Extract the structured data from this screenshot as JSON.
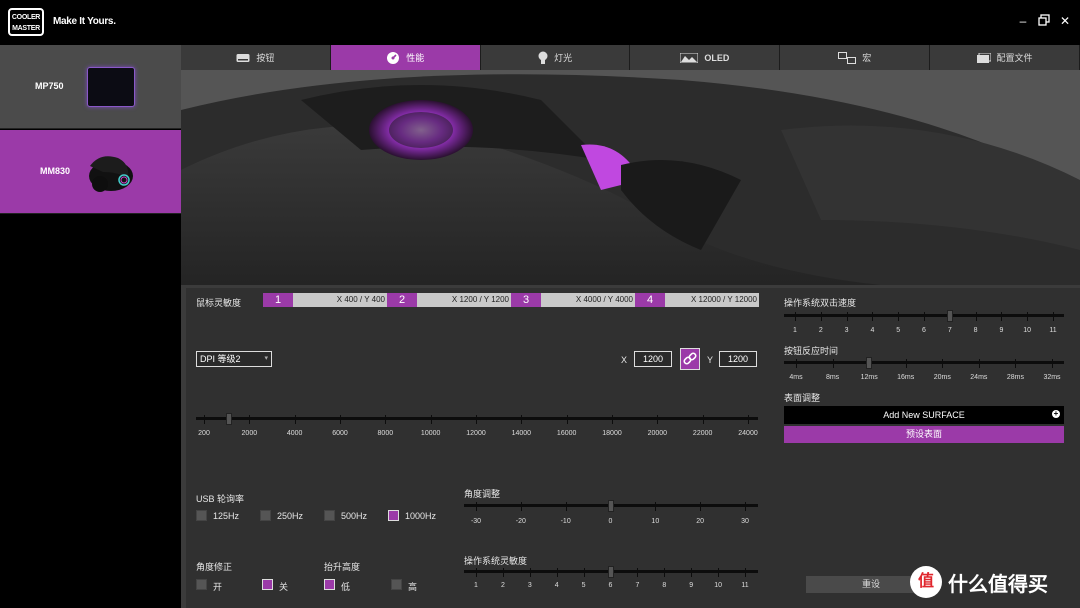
{
  "app": {
    "logo_text": "COOLER MASTER",
    "slogan": "Make It Yours.",
    "window_controls": [
      "minimize",
      "maximize",
      "close"
    ]
  },
  "devices": [
    {
      "name": "MP750",
      "selected": false
    },
    {
      "name": "MM830",
      "selected": true
    }
  ],
  "tabs": [
    {
      "label": "按钮",
      "icon": "keyboard-icon",
      "active": false
    },
    {
      "label": "性能",
      "icon": "speedometer-icon",
      "active": true
    },
    {
      "label": "灯光",
      "icon": "bulb-icon",
      "active": false
    },
    {
      "label": "OLED",
      "icon": "display-icon",
      "active": false
    },
    {
      "label": "宏",
      "icon": "macro-icon",
      "active": false
    },
    {
      "label": "配置文件",
      "icon": "folder-icon",
      "active": false
    }
  ],
  "dpi": {
    "title": "鼠标灵敏度",
    "stages": [
      {
        "num": "1",
        "value": "X 400 / Y 400"
      },
      {
        "num": "2",
        "value": "X 1200 / Y 1200"
      },
      {
        "num": "3",
        "value": "X 4000 / Y 4000"
      },
      {
        "num": "4",
        "value": "X 12000 / Y 12000"
      }
    ],
    "level_select": "DPI 等级2",
    "x_label": "X",
    "x_value": "1200",
    "y_label": "Y",
    "y_value": "1200",
    "slider_ticks": [
      "200",
      "2000",
      "4000",
      "6000",
      "8000",
      "10000",
      "12000",
      "14000",
      "16000",
      "18000",
      "20000",
      "22000",
      "24000"
    ],
    "slider_value": 1200
  },
  "usb_polling": {
    "title": "USB 轮询率",
    "options": [
      {
        "label": "125Hz",
        "checked": false
      },
      {
        "label": "250Hz",
        "checked": false
      },
      {
        "label": "500Hz",
        "checked": false
      },
      {
        "label": "1000Hz",
        "checked": true
      }
    ]
  },
  "angle_adjust": {
    "title": "角度调整",
    "ticks": [
      "-30",
      "-20",
      "-10",
      "0",
      "10",
      "20",
      "30"
    ],
    "value": 0
  },
  "angle_snap": {
    "title": "角度修正",
    "options": [
      {
        "label": "开",
        "checked": false
      },
      {
        "label": "关",
        "checked": true
      }
    ]
  },
  "lift_off": {
    "title": "抬升高度",
    "options": [
      {
        "label": "低",
        "checked": true
      },
      {
        "label": "高",
        "checked": false
      }
    ]
  },
  "os_sensitivity": {
    "title": "操作系统灵敏度",
    "ticks": [
      "1",
      "2",
      "3",
      "4",
      "5",
      "6",
      "7",
      "8",
      "9",
      "10",
      "11"
    ],
    "value": 6
  },
  "double_click": {
    "title": "操作系统双击速度",
    "ticks": [
      "1",
      "2",
      "3",
      "4",
      "5",
      "6",
      "7",
      "8",
      "9",
      "10",
      "11"
    ],
    "value": 7
  },
  "response_time": {
    "title": "按钮反应时间",
    "ticks": [
      "4ms",
      "8ms",
      "12ms",
      "16ms",
      "20ms",
      "24ms",
      "28ms",
      "32ms"
    ],
    "value": "12ms"
  },
  "surface": {
    "title": "表面调整",
    "add_label": "Add New SURFACE",
    "preset_label": "预设表面"
  },
  "reset_label": "重设",
  "watermark": {
    "symbol": "值",
    "text": "什么值得买"
  },
  "colors": {
    "accent": "#9b3aa8",
    "panel": "#303030",
    "background": "#000000"
  }
}
